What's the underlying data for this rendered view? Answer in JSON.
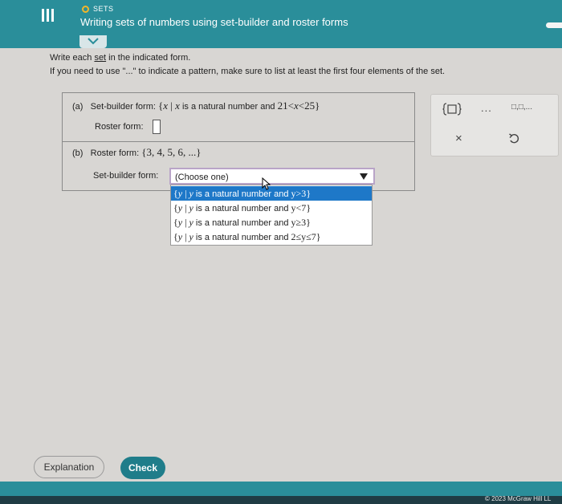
{
  "header": {
    "topic": "SETS",
    "title": "Writing sets of numbers using set-builder and roster forms"
  },
  "instructions": {
    "line1_prefix": "Write each ",
    "line1_link": "set",
    "line1_suffix": " in the indicated form.",
    "line2": "If you need to use \"...\" to indicate a pattern, make sure to list at least the first four elements of the set."
  },
  "part_a": {
    "label": "(a)",
    "setbuilder_label": "Set-builder form:",
    "set_open": "{",
    "var": "x",
    "bar": "|",
    "var2": "x",
    "condition": "is a natural number and",
    "lower": "21",
    "lt1": "<",
    "var3": "x",
    "lt2": "<",
    "upper": "25",
    "set_close": "}",
    "roster_label": "Roster form:",
    "roster_value": ""
  },
  "part_b": {
    "label": "(b)",
    "roster_label": "Roster form:",
    "roster_value": "{3, 4, 5, 6, ...}",
    "setbuilder_label": "Set-builder form:",
    "select_value": "(Choose one)",
    "options": [
      {
        "open": "{",
        "var": "y",
        "bar": "|",
        "var2": "y",
        "text": "is a natural number and",
        "expr": "y>3",
        "close": "}"
      },
      {
        "open": "{",
        "var": "y",
        "bar": "|",
        "var2": "y",
        "text": "is a natural number and",
        "expr": "y<7",
        "close": "}"
      },
      {
        "open": "{",
        "var": "y",
        "bar": "|",
        "var2": "y",
        "text": "is a natural number and",
        "expr": "y≥3",
        "close": "}"
      },
      {
        "open": "{",
        "var": "y",
        "bar": "|",
        "var2": "y",
        "text": "is a natural number and",
        "expr": "2≤y≤7",
        "close": "}"
      }
    ]
  },
  "tools": {
    "ellipsis": "...",
    "list": "□,□,...",
    "clear": "×",
    "undo_icon": "undo-icon",
    "braces_icon": "set-braces-icon"
  },
  "buttons": {
    "explanation": "Explanation",
    "check": "Check"
  },
  "footer": {
    "copyright": "© 2023 McGraw Hill LL"
  },
  "colors": {
    "header": "#2a8e9a",
    "check": "#1f7d8a",
    "selected_option": "#1e78c8",
    "status_dot": "#f3b62a"
  }
}
